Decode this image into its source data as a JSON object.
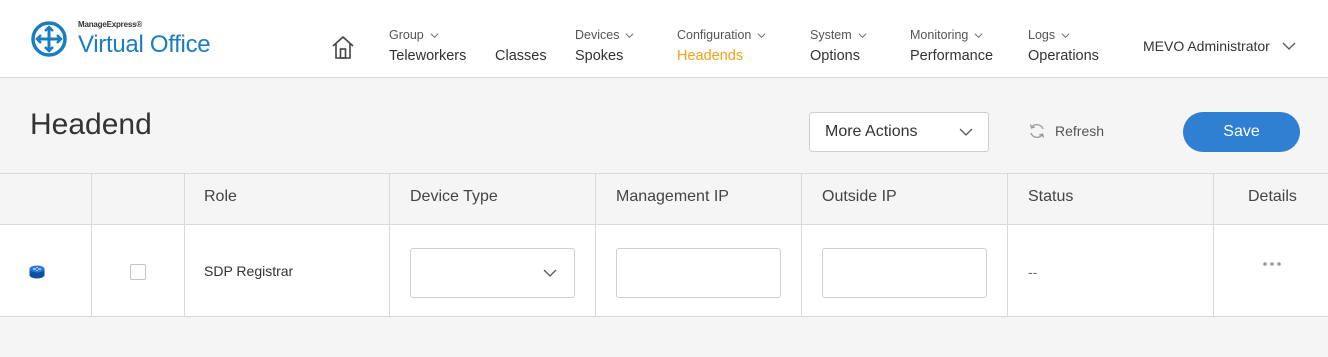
{
  "brand": {
    "small": "ManageExpress®",
    "big": "Virtual Office",
    "color": "#1a7dc0"
  },
  "nav": {
    "home_icon": "home-icon",
    "items": [
      {
        "top": "Group",
        "main": "Teleworkers",
        "has_chevron": true,
        "active": false
      },
      {
        "top": "",
        "main": "Classes",
        "has_chevron": false,
        "active": false
      },
      {
        "top": "Devices",
        "main": "Spokes",
        "has_chevron": true,
        "active": false
      },
      {
        "top": "Configuration",
        "main": "Headends",
        "has_chevron": true,
        "active": true
      },
      {
        "top": "System",
        "main": "Options",
        "has_chevron": true,
        "active": false
      },
      {
        "top": "Monitoring",
        "main": "Performance",
        "has_chevron": true,
        "active": false
      },
      {
        "top": "Logs",
        "main": "Operations",
        "has_chevron": true,
        "active": false
      }
    ],
    "active_color": "#f0a215",
    "user": "MEVO Administrator"
  },
  "toolbar": {
    "title": "Headend",
    "more_actions": "More Actions",
    "refresh": "Refresh",
    "save": "Save",
    "save_color": "#2f7fd3"
  },
  "table": {
    "headers": [
      "",
      "",
      "Role",
      "Device Type",
      "Management IP",
      "Outside IP",
      "Status",
      "Details"
    ],
    "rows": [
      {
        "icon": "router-icon",
        "checked": false,
        "role": "SDP Registrar",
        "device_type": "",
        "management_ip": "",
        "outside_ip": "",
        "status": "--",
        "details_icon": "more-horizontal-icon"
      }
    ]
  }
}
